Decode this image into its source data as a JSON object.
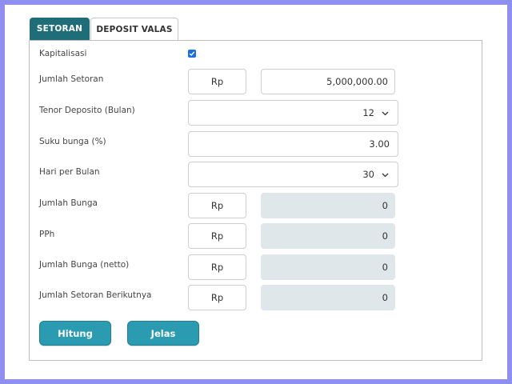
{
  "tabs": [
    {
      "label": "SETORAN",
      "active": true
    },
    {
      "label": "DEPOSIT VALAS",
      "active": false
    }
  ],
  "form": {
    "kapitalisasi": {
      "label": "Kapitalisasi",
      "checked": true
    },
    "jumlah_setoran": {
      "label": "Jumlah Setoran",
      "currency": "Rp",
      "value": "5,000,000.00"
    },
    "tenor": {
      "label": "Tenor Deposito (Bulan)",
      "value": "12"
    },
    "suku_bunga": {
      "label": "Suku bunga (%)",
      "value": "3.00"
    },
    "hari_per_bulan": {
      "label": "Hari per Bulan",
      "value": "30"
    },
    "jumlah_bunga": {
      "label": "Jumlah Bunga",
      "currency": "Rp",
      "value": "0"
    },
    "pph": {
      "label": "PPh",
      "currency": "Rp",
      "value": "0"
    },
    "jumlah_bunga_netto": {
      "label": "Jumlah Bunga (netto)",
      "currency": "Rp",
      "value": "0"
    },
    "jumlah_setoran_berikutnya": {
      "label": "Jumlah Setoran Berikutnya",
      "currency": "Rp",
      "value": "0"
    }
  },
  "buttons": {
    "hitung": "Hitung",
    "jelas": "Jelas"
  },
  "colors": {
    "background": "#8f8ff2",
    "tab_active": "#1f6d78",
    "button": "#2a9bb0",
    "readonly_field": "#dfe7ea",
    "checkbox": "#1a6fe0"
  }
}
